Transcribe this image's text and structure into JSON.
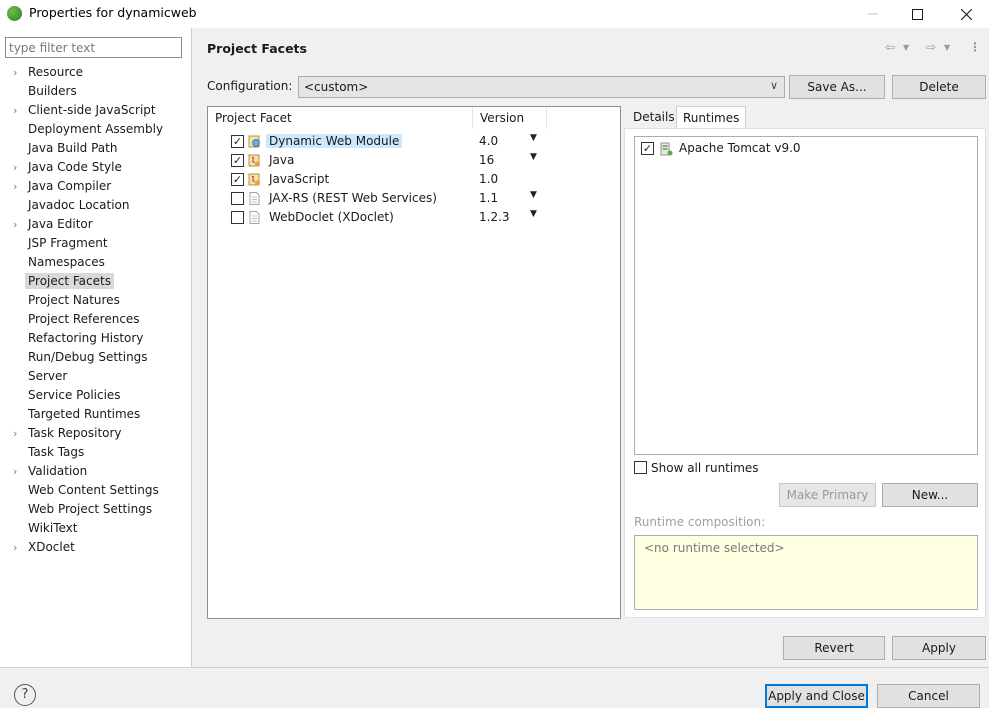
{
  "window": {
    "title": "Properties for dynamicweb",
    "minimize_icon": "minimize-icon",
    "maximize_icon": "maximize-icon",
    "close_icon": "close-icon"
  },
  "sidebar": {
    "filter_placeholder": "type filter text",
    "items": [
      {
        "label": "Resource",
        "expandable": true
      },
      {
        "label": "Builders",
        "expandable": false
      },
      {
        "label": "Client-side JavaScript",
        "expandable": true
      },
      {
        "label": "Deployment Assembly",
        "expandable": false
      },
      {
        "label": "Java Build Path",
        "expandable": false
      },
      {
        "label": "Java Code Style",
        "expandable": true
      },
      {
        "label": "Java Compiler",
        "expandable": true
      },
      {
        "label": "Javadoc Location",
        "expandable": false
      },
      {
        "label": "Java Editor",
        "expandable": true
      },
      {
        "label": "JSP Fragment",
        "expandable": false
      },
      {
        "label": "Namespaces",
        "expandable": false
      },
      {
        "label": "Project Facets",
        "expandable": false,
        "selected": true
      },
      {
        "label": "Project Natures",
        "expandable": false
      },
      {
        "label": "Project References",
        "expandable": false
      },
      {
        "label": "Refactoring History",
        "expandable": false
      },
      {
        "label": "Run/Debug Settings",
        "expandable": false
      },
      {
        "label": "Server",
        "expandable": false
      },
      {
        "label": "Service Policies",
        "expandable": false
      },
      {
        "label": "Targeted Runtimes",
        "expandable": false
      },
      {
        "label": "Task Repository",
        "expandable": true
      },
      {
        "label": "Task Tags",
        "expandable": false
      },
      {
        "label": "Validation",
        "expandable": true
      },
      {
        "label": "Web Content Settings",
        "expandable": false
      },
      {
        "label": "Web Project Settings",
        "expandable": false
      },
      {
        "label": "WikiText",
        "expandable": false
      },
      {
        "label": "XDoclet",
        "expandable": true
      }
    ]
  },
  "main": {
    "title": "Project Facets",
    "configuration_label": "Configuration:",
    "configuration_value": "<custom>",
    "save_as_label": "Save As...",
    "delete_label": "Delete",
    "facet_table": {
      "col_facet": "Project Facet",
      "col_version": "Version",
      "rows": [
        {
          "name": "Dynamic Web Module",
          "version": "4.0",
          "checked": true,
          "dropdown": true,
          "highlighted": true,
          "icon": "web-module-icon"
        },
        {
          "name": "Java",
          "version": "16",
          "checked": true,
          "dropdown": true,
          "highlighted": false,
          "icon": "java-facet-icon"
        },
        {
          "name": "JavaScript",
          "version": "1.0",
          "checked": true,
          "dropdown": false,
          "highlighted": false,
          "icon": "javascript-facet-icon"
        },
        {
          "name": "JAX-RS (REST Web Services)",
          "version": "1.1",
          "checked": false,
          "dropdown": true,
          "highlighted": false,
          "icon": "document-icon"
        },
        {
          "name": "WebDoclet (XDoclet)",
          "version": "1.2.3",
          "checked": false,
          "dropdown": true,
          "highlighted": false,
          "icon": "document-icon"
        }
      ]
    },
    "tabs": [
      {
        "label": "Details",
        "active": false
      },
      {
        "label": "Runtimes",
        "active": true
      }
    ],
    "runtimes": [
      {
        "label": "Apache Tomcat v9.0",
        "checked": true
      }
    ],
    "show_all_runtimes_label": "Show all runtimes",
    "make_primary_label": "Make Primary",
    "new_label": "New...",
    "runtime_composition_label": "Runtime composition:",
    "runtime_composition_value": "<no runtime selected>",
    "revert_label": "Revert",
    "apply_label": "Apply"
  },
  "footer": {
    "help_symbol": "?",
    "apply_close_label": "Apply and Close",
    "cancel_label": "Cancel"
  },
  "colors": {
    "selection_highlight": "#cce8ff",
    "default_button_border": "#0078d7",
    "composition_background": "#ffffe1"
  }
}
